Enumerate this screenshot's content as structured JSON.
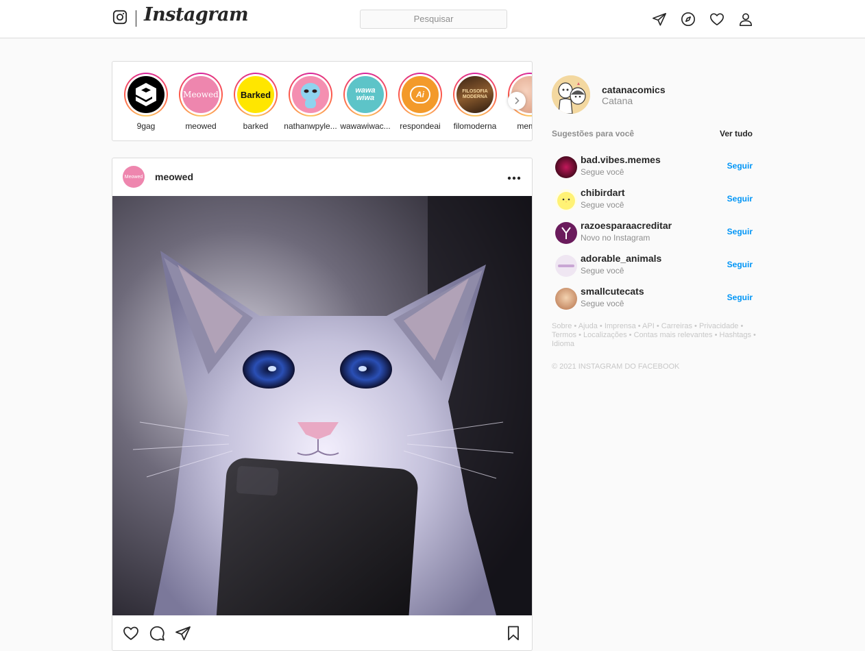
{
  "nav": {
    "wordmark": "Instagram",
    "search_placeholder": "Pesquisar",
    "icons": [
      "instagram-glyph-icon",
      "direct-send-icon",
      "explore-compass-icon",
      "activity-heart-icon",
      "profile-icon"
    ]
  },
  "stories": [
    {
      "name": "9gag",
      "avatar_text": "9",
      "bg": "#000000",
      "fg": "#ffffff"
    },
    {
      "name": "meowed",
      "avatar_text": "Meowed",
      "bg": "#ee86ae",
      "fg": "#ffffff"
    },
    {
      "name": "barked",
      "avatar_text": "Barked",
      "bg": "#ffe600",
      "fg": "#111111"
    },
    {
      "name": "nathanwpyle...",
      "avatar_text": "",
      "bg": "#f48fb1",
      "fg": "#7fc7e8"
    },
    {
      "name": "wawawiwac...",
      "avatar_text": "wawa wiwa",
      "bg": "#5dc4c8",
      "fg": "#ffffff"
    },
    {
      "name": "respondeai",
      "avatar_text": "Ai",
      "bg": "#f39a2a",
      "fg": "#ffffff"
    },
    {
      "name": "filomoderna",
      "avatar_text": "FILOSOFIA MODERNA",
      "bg": "#6b3a1f",
      "fg": "#f5d7a0"
    },
    {
      "name": "memer",
      "avatar_text": "",
      "bg": "#e8b49a",
      "fg": "#ffffff"
    }
  ],
  "post": {
    "username": "meowed",
    "avatar_text": "Meowed",
    "image_alt": "cat looking at smartphone",
    "actions": [
      "like-heart-icon",
      "comment-icon",
      "share-icon",
      "save-bookmark-icon"
    ]
  },
  "sidebar": {
    "me": {
      "username": "catanacomics",
      "fullname": "Catana"
    },
    "suggestions_title": "Sugestões para você",
    "see_all": "Ver tudo",
    "suggestions": [
      {
        "username": "bad.vibes.memes",
        "subtitle": "Segue você",
        "follow": "Seguir",
        "color": "#7a0d1f"
      },
      {
        "username": "chibirdart",
        "subtitle": "Segue você",
        "follow": "Seguir",
        "color": "#fff275"
      },
      {
        "username": "razoesparaacreditar",
        "subtitle": "Novo no Instagram",
        "follow": "Seguir",
        "color": "#6a1b5c"
      },
      {
        "username": "adorable_animals",
        "subtitle": "Segue você",
        "follow": "Seguir",
        "color": "#efe6f2"
      },
      {
        "username": "smallcutecats",
        "subtitle": "Segue você",
        "follow": "Seguir",
        "color": "#d9a77a"
      }
    ],
    "footer_links": [
      "Sobre",
      "Ajuda",
      "Imprensa",
      "API",
      "Carreiras",
      "Privacidade",
      "Termos",
      "Localizações",
      "Contas mais relevantes",
      "Hashtags",
      "Idioma"
    ],
    "copyright": "© 2021 INSTAGRAM DO FACEBOOK"
  }
}
